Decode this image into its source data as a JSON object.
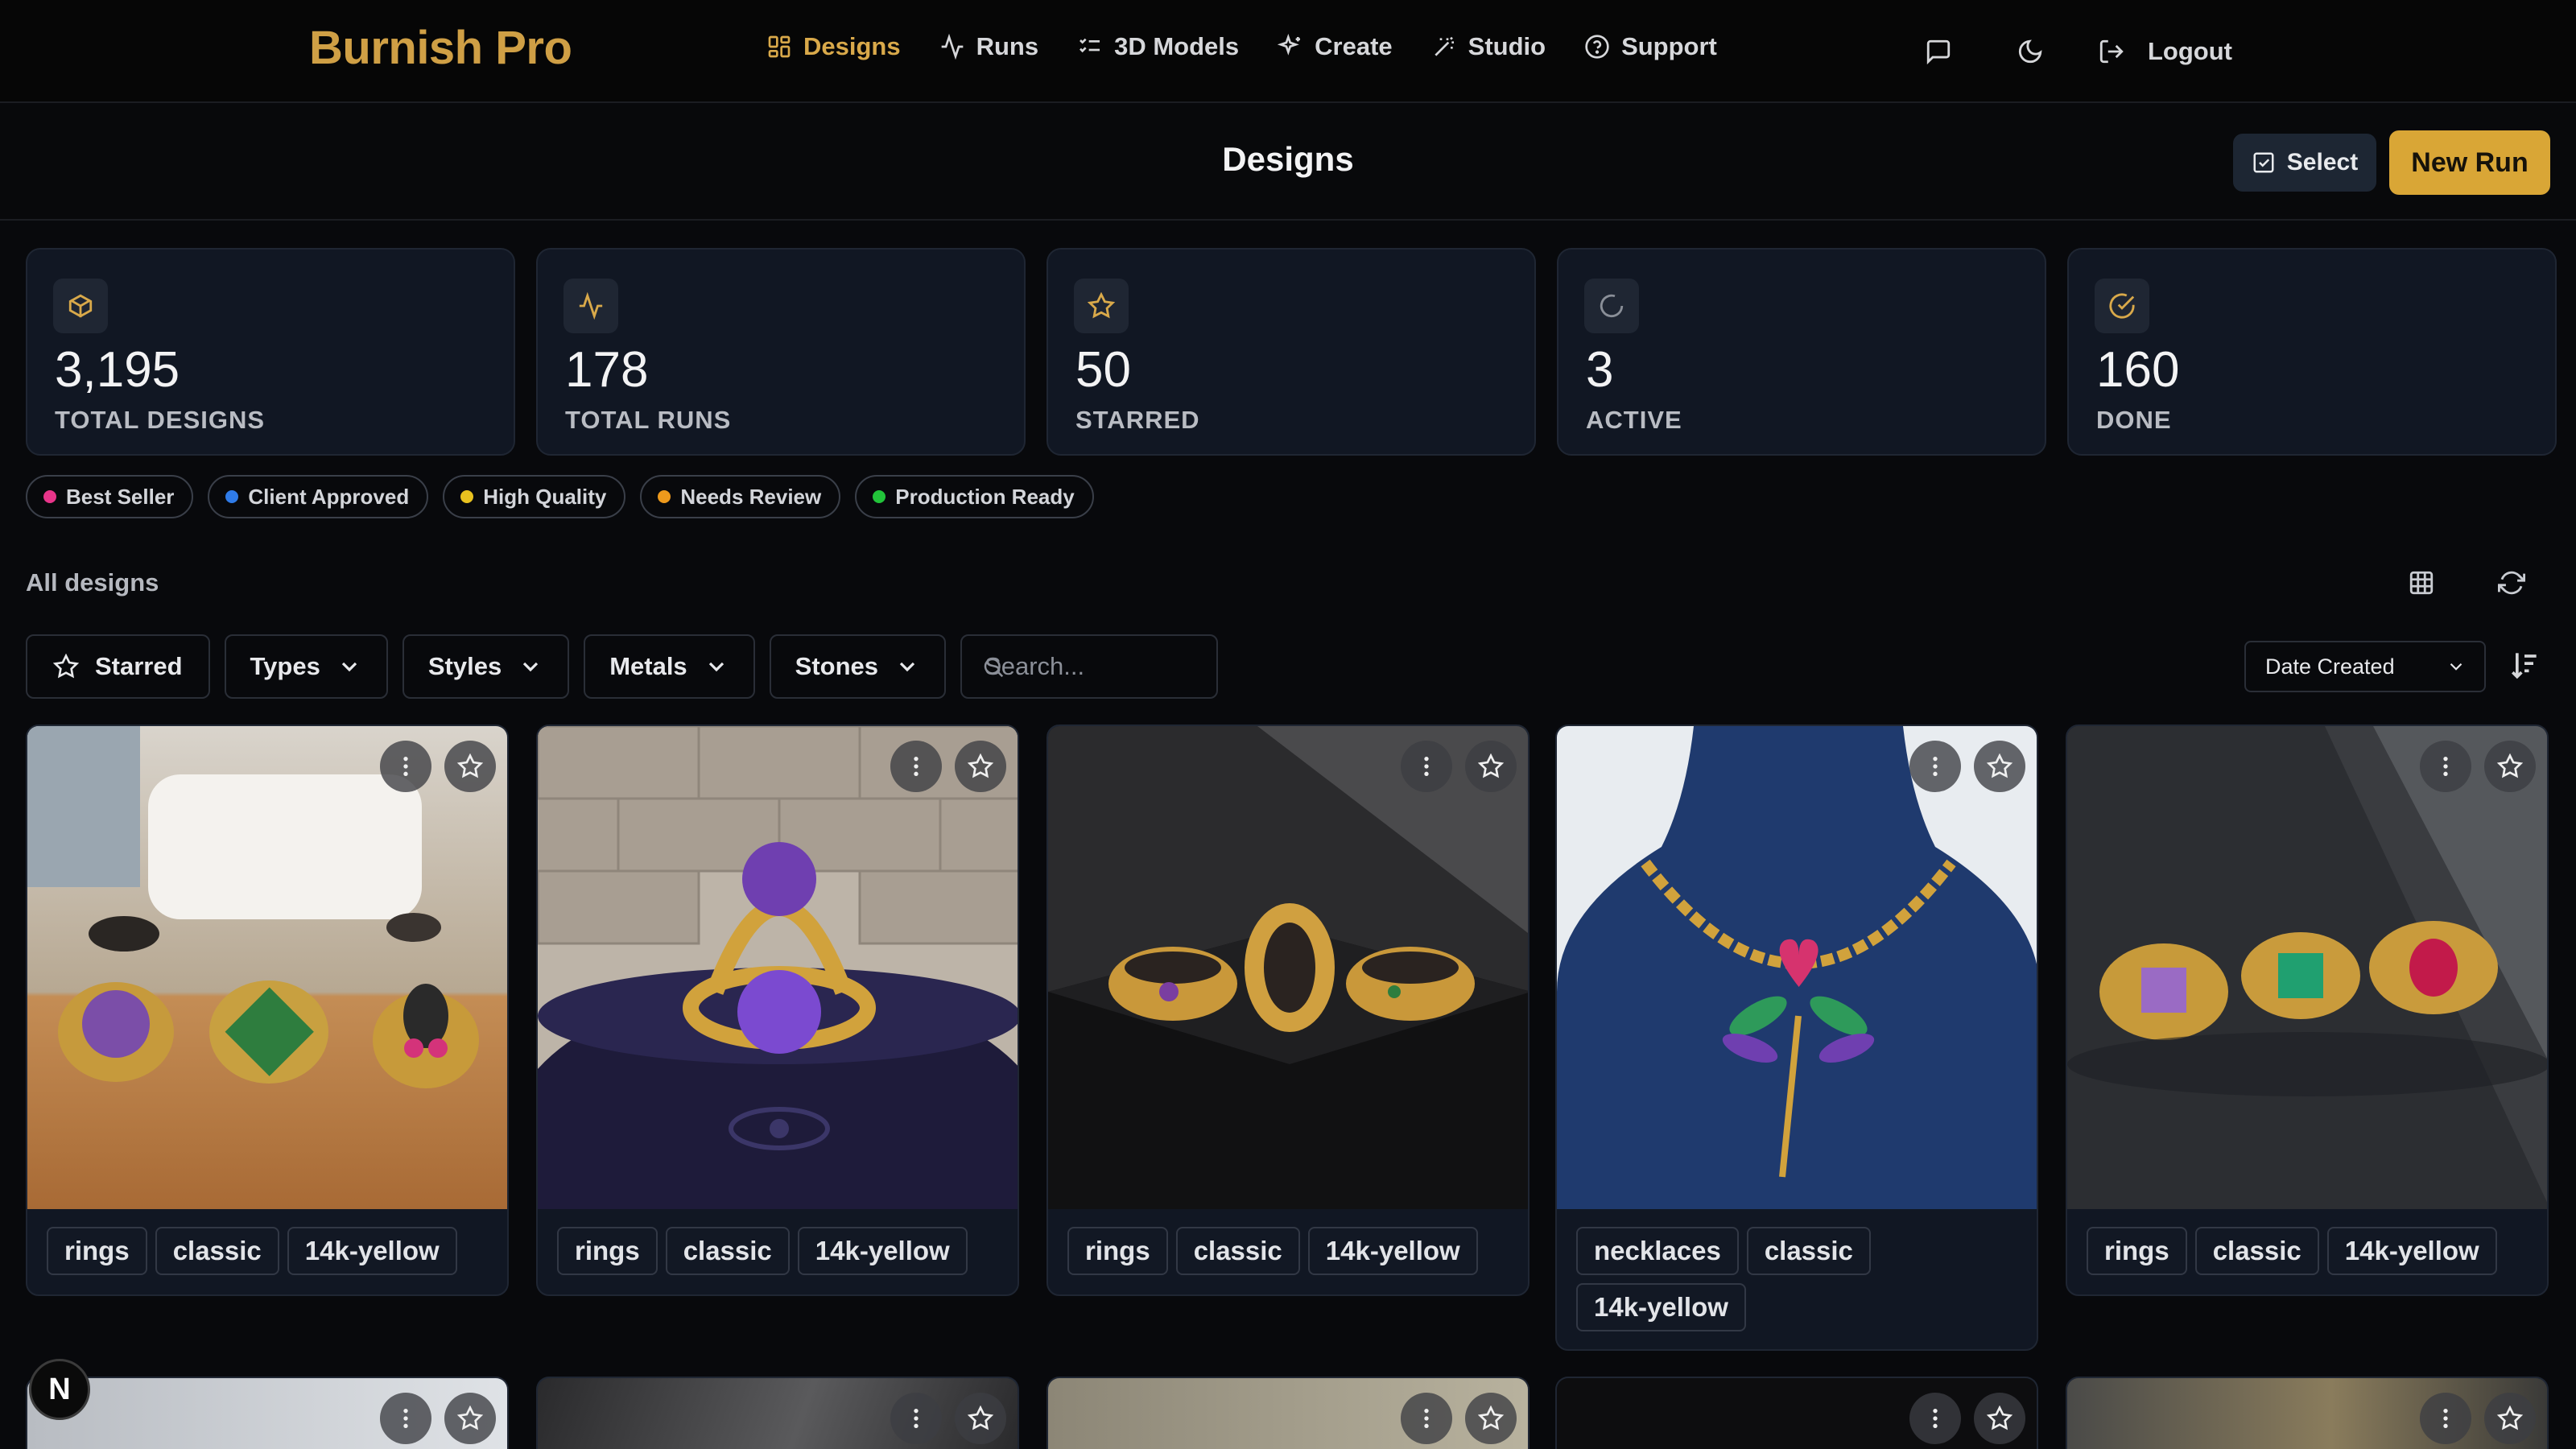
{
  "brand": "Burnish Pro",
  "nav": {
    "items": [
      {
        "label": "Designs",
        "icon": "grid-icon",
        "active": true
      },
      {
        "label": "Runs",
        "icon": "activity-icon"
      },
      {
        "label": "3D Models",
        "icon": "list-icon"
      },
      {
        "label": "Create",
        "icon": "sparkles-icon"
      },
      {
        "label": "Studio",
        "icon": "wand-icon"
      },
      {
        "label": "Support",
        "icon": "help-icon"
      }
    ],
    "logout": "Logout"
  },
  "page": {
    "title": "Designs",
    "select_label": "Select",
    "new_run_label": "New Run"
  },
  "stats": [
    {
      "value": "3,195",
      "label": "TOTAL DESIGNS",
      "icon": "box-icon"
    },
    {
      "value": "178",
      "label": "TOTAL RUNS",
      "icon": "activity-icon"
    },
    {
      "value": "50",
      "label": "STARRED",
      "icon": "star-icon"
    },
    {
      "value": "3",
      "label": "ACTIVE",
      "icon": "loader-icon"
    },
    {
      "value": "160",
      "label": "DONE",
      "icon": "check-circle-icon"
    }
  ],
  "tags": [
    {
      "label": "Best Seller",
      "color": "#e8358a"
    },
    {
      "label": "Client Approved",
      "color": "#2f7be8"
    },
    {
      "label": "High Quality",
      "color": "#e8c21f"
    },
    {
      "label": "Needs Review",
      "color": "#ee9a1c"
    },
    {
      "label": "Production Ready",
      "color": "#22c43a"
    }
  ],
  "section_title": "All designs",
  "filters": {
    "starred": "Starred",
    "types": "Types",
    "styles": "Styles",
    "metals": "Metals",
    "stones": "Stones",
    "search_placeholder": "Search...",
    "sort_value": "Date Created"
  },
  "cards": [
    {
      "chips": [
        "rings",
        "classic",
        "14k-yellow"
      ],
      "scene": "three rings with purple, green and bunny stones on wooden table"
    },
    {
      "chips": [
        "rings",
        "classic",
        "14k-yellow"
      ],
      "scene": "gold ring with purple amethyst on velvet cushion"
    },
    {
      "chips": [
        "rings",
        "classic",
        "14k-yellow"
      ],
      "scene": "three engraved gold bands on black block"
    },
    {
      "chips": [
        "necklaces",
        "classic",
        "14k-yellow"
      ],
      "scene": "gold chain necklace with palm pendant on blue bust"
    },
    {
      "chips": [
        "rings",
        "classic",
        "14k-yellow"
      ],
      "scene": "three gemstone rings in sunlight"
    }
  ],
  "accent_color": "#d9a636"
}
